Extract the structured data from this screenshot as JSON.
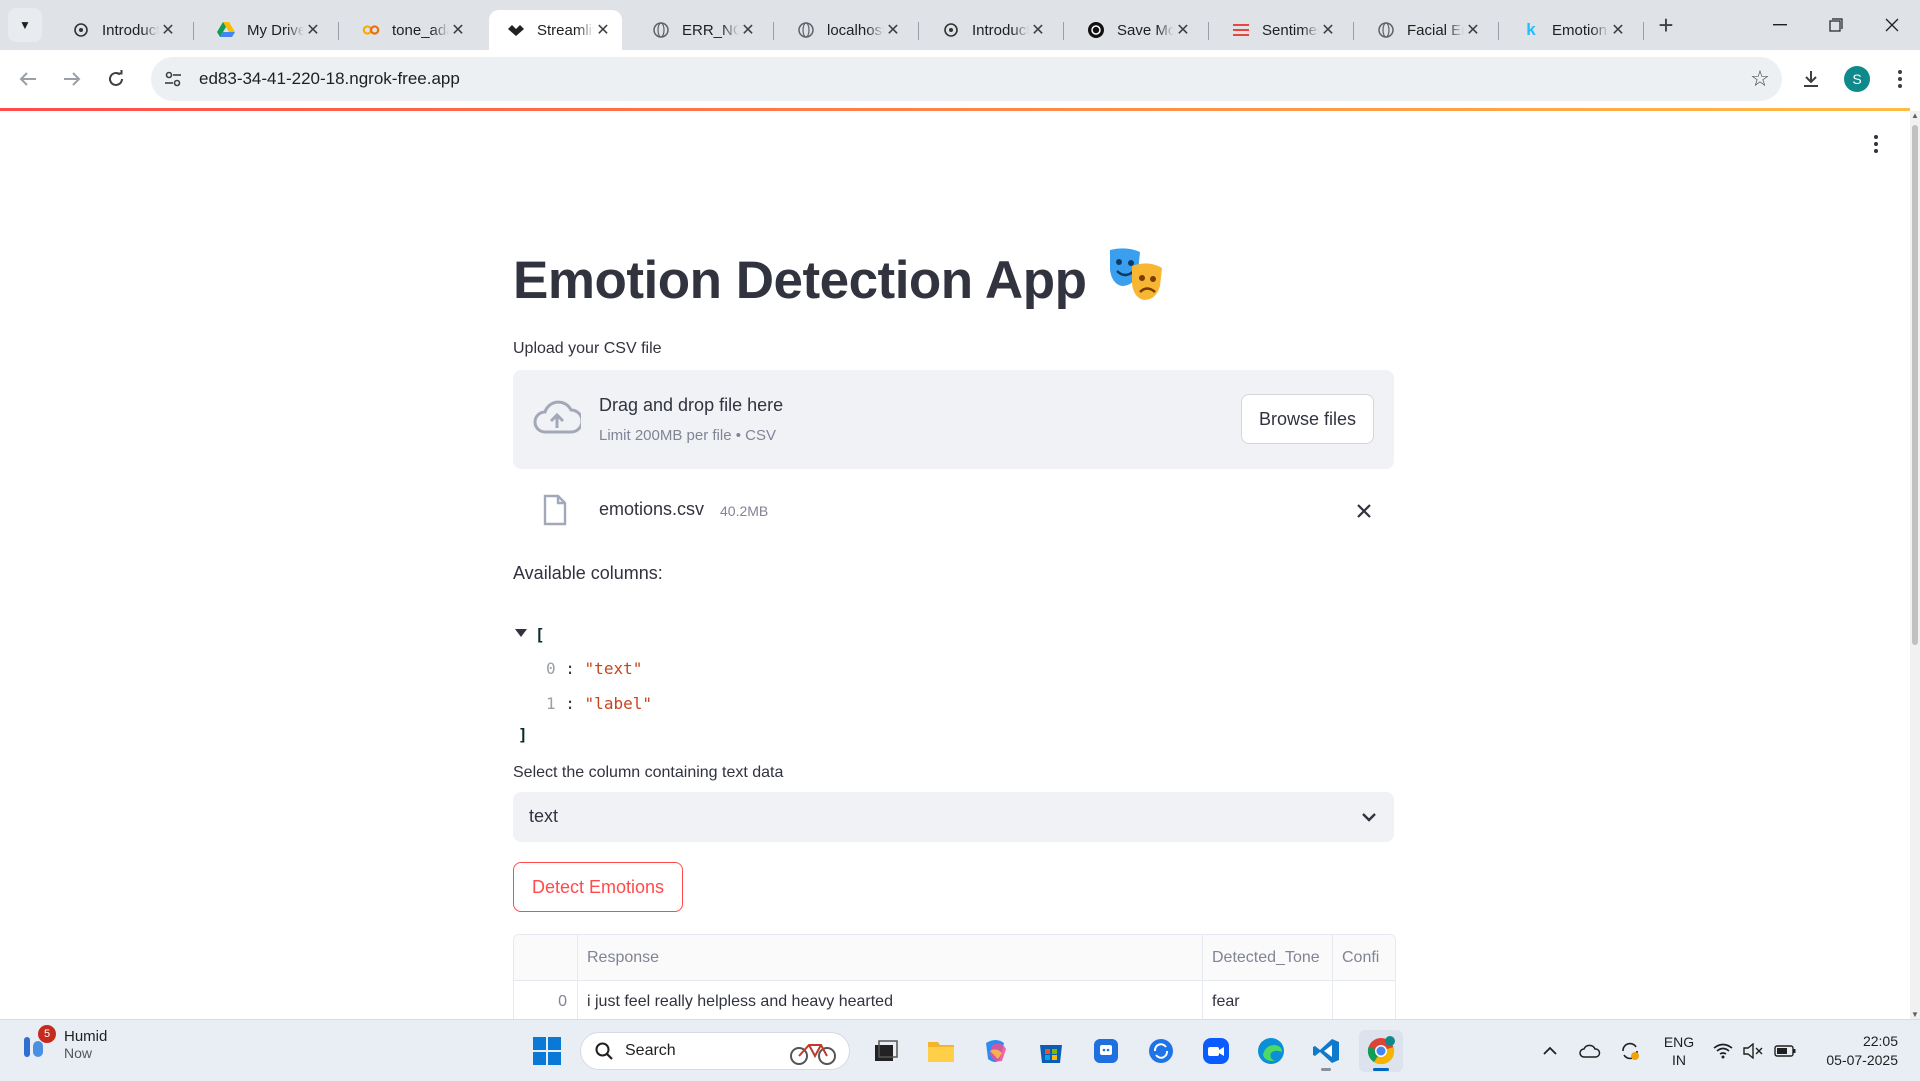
{
  "browser": {
    "tabs": [
      {
        "title": "Introduction",
        "icon": "openai-icon"
      },
      {
        "title": "My Drive",
        "icon": "google-drive-icon"
      },
      {
        "title": "tone_adapter",
        "icon": "colab-icon"
      },
      {
        "title": "Streamlit",
        "icon": "streamlit-icon"
      },
      {
        "title": "ERR_NGROK",
        "icon": "globe-icon"
      },
      {
        "title": "localhost",
        "icon": "globe-icon"
      },
      {
        "title": "Introduction",
        "icon": "openai-icon"
      },
      {
        "title": "Save Model",
        "icon": "openai-icon"
      },
      {
        "title": "Sentiment",
        "icon": "list-icon"
      },
      {
        "title": "Facial Emotion",
        "icon": "globe-icon"
      },
      {
        "title": "Emotion",
        "icon": "kaggle-icon"
      }
    ],
    "active_tab_index": 3,
    "url": "ed83-34-41-220-18.ngrok-free.app",
    "profile_initial": "S"
  },
  "app": {
    "title": "Emotion Detection App",
    "title_emoji": "🎭",
    "upload_label": "Upload your CSV file",
    "dropzone_text": "Drag and drop file here",
    "dropzone_limit": "Limit 200MB per file • CSV",
    "browse_label": "Browse files",
    "file": {
      "name": "emotions.csv",
      "size": "40.2MB"
    },
    "available_columns_label": "Available columns:",
    "json_view": {
      "open_bracket": "[",
      "close_bracket": "]",
      "items": [
        {
          "index": "0",
          "value": "\"text\""
        },
        {
          "index": "1",
          "value": "\"label\""
        }
      ]
    },
    "select_label": "Select the column containing text data",
    "select_value": "text",
    "detect_button": "Detect Emotions",
    "table": {
      "columns": [
        "",
        "Response",
        "Detected_Tone",
        "Confi"
      ],
      "rows": [
        {
          "index": "0",
          "response": "i just feel really helpless and heavy hearted",
          "tone": "fear",
          "confidence": ""
        }
      ]
    },
    "accent_color": "#ff4b4b"
  },
  "taskbar": {
    "weather_badge": "5",
    "weather_title": "Humid",
    "weather_sub": "Now",
    "search_label": "Search",
    "lang_1": "ENG",
    "lang_2": "IN",
    "time": "22:05",
    "date": "05-07-2025"
  }
}
